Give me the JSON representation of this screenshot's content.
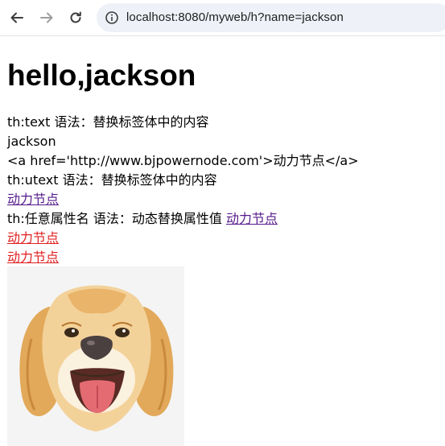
{
  "browser": {
    "url": "localhost:8080/myweb/h?name=jackson",
    "back_icon": "arrow-left-icon",
    "forward_icon": "arrow-right-icon",
    "reload_icon": "reload-icon",
    "site_info_icon": "info-icon"
  },
  "page": {
    "heading": "hello,jackson",
    "th_text_label": "th:text 语法：替换标签体中的内容",
    "th_text_value": "jackson",
    "th_text_raw": "<a href='http://www.bjpowernode.com'>动力节点</a>",
    "th_utext_label": "th:utext 语法：替换标签体中的内容",
    "th_utext_link": "动力节点",
    "th_attr_label": "th:任意属性名 语法：动态替换属性值",
    "th_attr_link": "动力节点",
    "red_link_1": "动力节点",
    "red_link_2": "动力节点",
    "image_subject": "golden-retriever-dog-illustration"
  },
  "colors": {
    "visited_link": "#551a8b",
    "red_link": "#e02020",
    "url_bar": "#eef1f8"
  }
}
